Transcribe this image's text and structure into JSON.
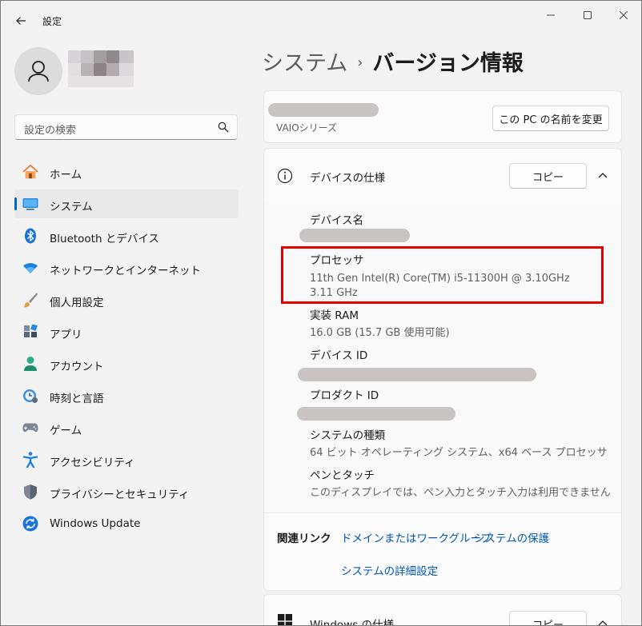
{
  "window": {
    "app_title": "設定"
  },
  "sidebar": {
    "search_placeholder": "設定の検索",
    "items": [
      {
        "label": "ホーム",
        "icon": "home-icon"
      },
      {
        "label": "システム",
        "icon": "system-icon",
        "selected": true
      },
      {
        "label": "Bluetooth とデバイス",
        "icon": "bluetooth-icon"
      },
      {
        "label": "ネットワークとインターネット",
        "icon": "wifi-icon"
      },
      {
        "label": "個人用設定",
        "icon": "brush-icon"
      },
      {
        "label": "アプリ",
        "icon": "apps-icon"
      },
      {
        "label": "アカウント",
        "icon": "account-icon"
      },
      {
        "label": "時刻と言語",
        "icon": "time-language-icon"
      },
      {
        "label": "ゲーム",
        "icon": "gamepad-icon"
      },
      {
        "label": "アクセシビリティ",
        "icon": "accessibility-icon"
      },
      {
        "label": "プライバシーとセキュリティ",
        "icon": "shield-icon"
      },
      {
        "label": "Windows Update",
        "icon": "update-icon"
      }
    ]
  },
  "header": {
    "parent": "システム",
    "separator": "›",
    "current": "バージョン情報"
  },
  "device_card": {
    "model": "VAIOシリーズ",
    "rename_button": "この PC の名前を変更"
  },
  "device_specs": {
    "title": "デバイスの仕様",
    "copy_button": "コピー",
    "rows": [
      {
        "label": "デバイス名",
        "value": ""
      },
      {
        "label": "プロセッサ",
        "value": "11th Gen Intel(R) Core(TM) i5-11300H @ 3.10GHz   3.11 GHz"
      },
      {
        "label": "実装 RAM",
        "value": "16.0 GB (15.7 GB 使用可能)"
      },
      {
        "label": "デバイス ID",
        "value": ""
      },
      {
        "label": "プロダクト ID",
        "value": ""
      },
      {
        "label": "システムの種類",
        "value": "64 ビット オペレーティング システム、x64 ベース プロセッサ"
      },
      {
        "label": "ペンとタッチ",
        "value": "このディスプレイでは、ペン入力とタッチ入力は利用できません"
      }
    ]
  },
  "related_links": {
    "label": "関連リンク",
    "links": [
      "ドメインまたはワークグループ",
      "システムの保護",
      "システムの詳細設定"
    ]
  },
  "windows_specs": {
    "title": "Windows の仕様",
    "copy_button": "コピー"
  },
  "colors": {
    "accent": "#0067c0",
    "link": "#0058b0",
    "highlight_box": "#e30000",
    "redaction": "#c9c3c3"
  }
}
